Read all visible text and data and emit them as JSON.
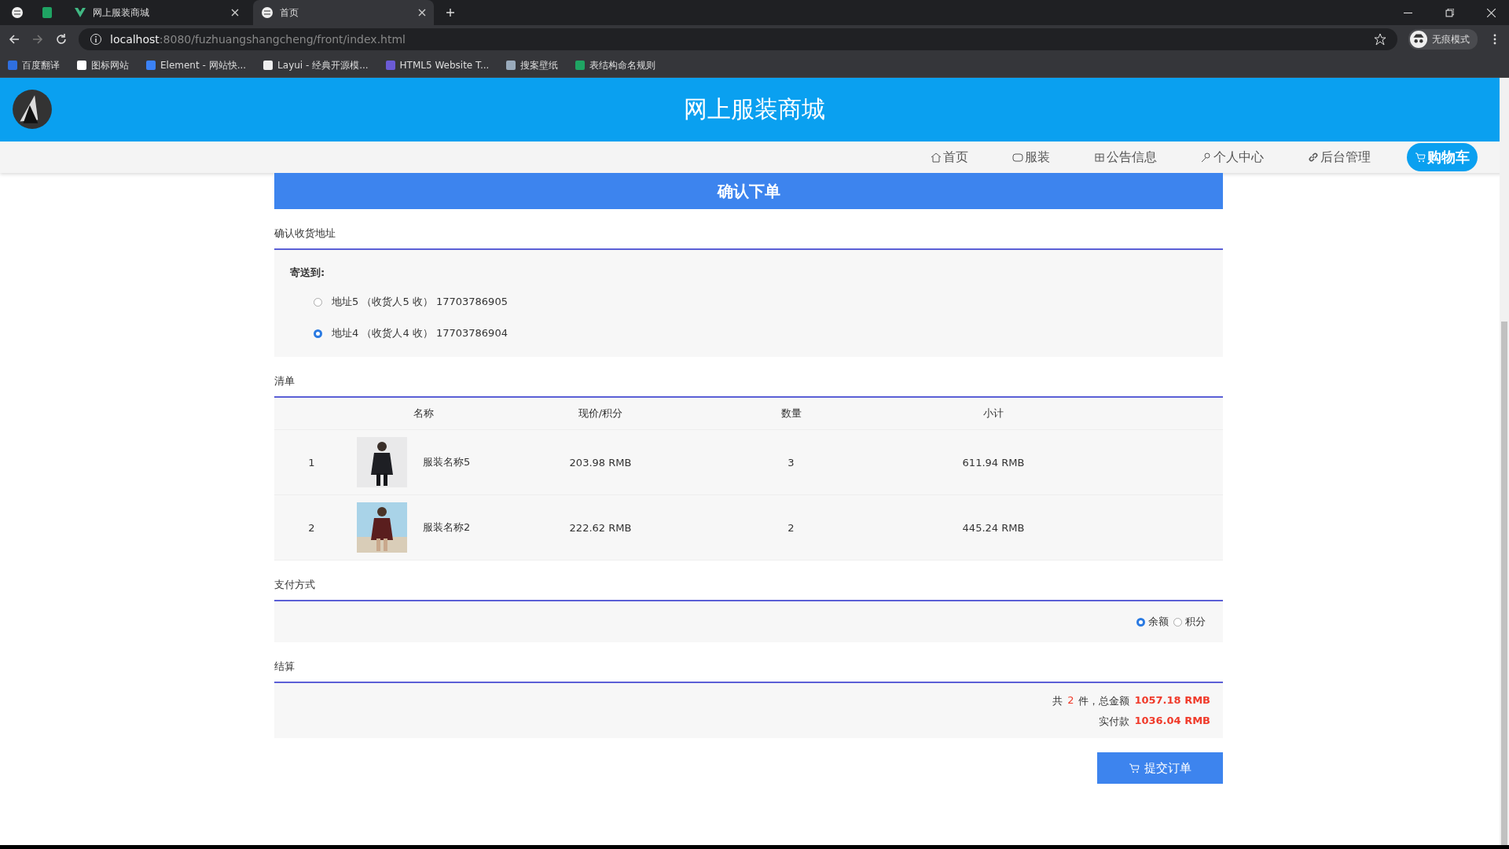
{
  "browser": {
    "tabs": [
      {
        "title": "网上服装商城",
        "selected": false
      },
      {
        "title": "首页",
        "selected": true
      }
    ],
    "url_host": "localhost",
    "url_rest": ":8080/fuzhuangshangcheng/front/index.html",
    "profile": "无痕模式",
    "bookmarks": [
      "百度翻译",
      "图标网站",
      "Element - 网站快...",
      "Layui - 经典开源模...",
      "HTML5 Website T...",
      "搜案壁纸",
      "表结构命名规则"
    ]
  },
  "header": {
    "title": "网上服装商城"
  },
  "nav": [
    {
      "label": "首页",
      "selected": false
    },
    {
      "label": "服装",
      "selected": false
    },
    {
      "label": "公告信息",
      "selected": false
    },
    {
      "label": "个人中心",
      "selected": false
    },
    {
      "label": "后台管理",
      "selected": false
    },
    {
      "label": "购物车",
      "selected": true
    }
  ],
  "page_title": "确认下单",
  "address": {
    "heading": "确认收货地址",
    "ship_to": "寄送到:",
    "options": [
      {
        "label": "地址5 （收货人5 收） 17703786905",
        "selected": false
      },
      {
        "label": "地址4 （收货人4 收） 17703786904",
        "selected": true
      }
    ]
  },
  "list": {
    "heading": "清单",
    "columns": [
      "名称",
      "现价/积分",
      "数量",
      "小计"
    ],
    "rows": [
      {
        "index": "1",
        "name": "服装名称5",
        "price": "203.98 RMB",
        "quantity": "3",
        "subtotal": "611.94 RMB"
      },
      {
        "index": "2",
        "name": "服装名称2",
        "price": "222.62 RMB",
        "quantity": "2",
        "subtotal": "445.24 RMB"
      }
    ]
  },
  "payment": {
    "heading": "支付方式",
    "options": [
      {
        "label": "余额",
        "selected": true
      },
      {
        "label": "积分",
        "selected": false
      }
    ]
  },
  "settlement": {
    "heading": "结算",
    "prefix": "共",
    "count": "2",
    "suffix": "件，总金额",
    "total": "1057.18 RMB",
    "paid_label": "实付款",
    "paid": "1036.04 RMB"
  },
  "submit": "提交订单"
}
